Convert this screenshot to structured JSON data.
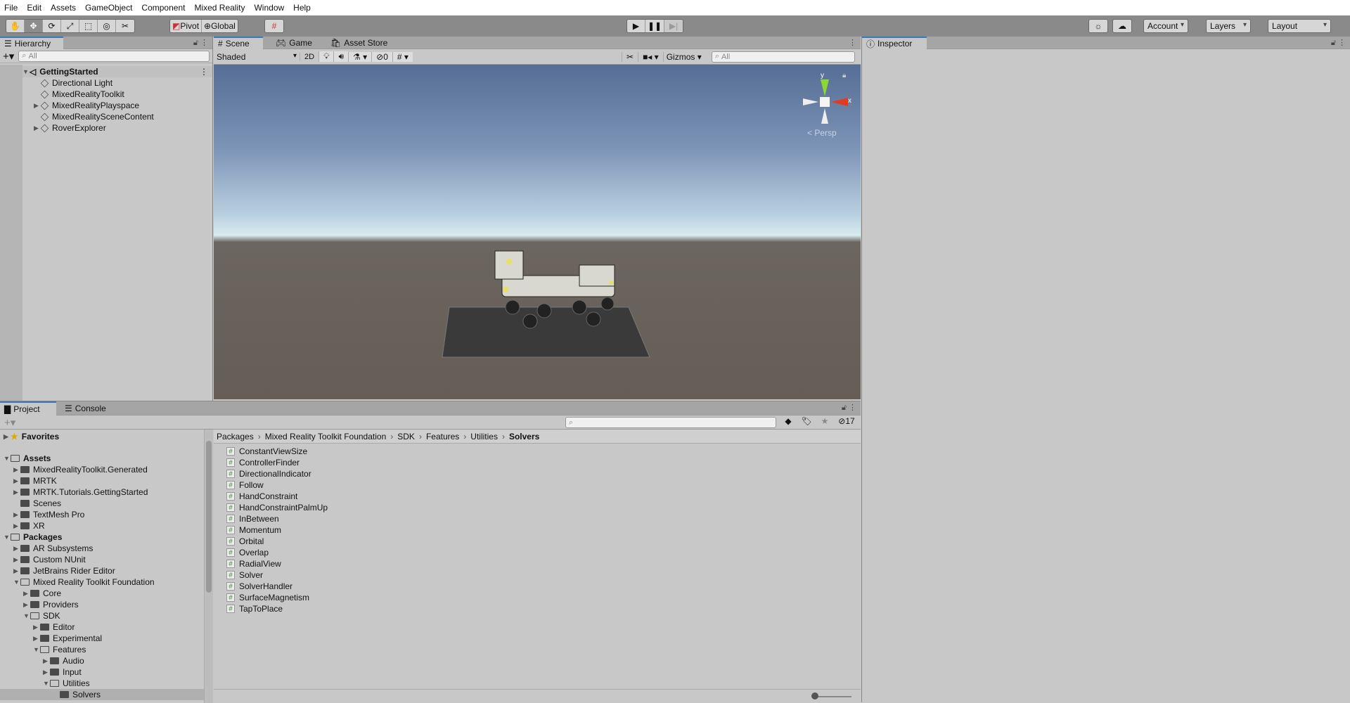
{
  "menu": [
    "File",
    "Edit",
    "Assets",
    "GameObject",
    "Component",
    "Mixed Reality",
    "Window",
    "Help"
  ],
  "toolbar": {
    "tools": [
      "hand-tool",
      "move-tool",
      "rotate-tool",
      "scale-tool",
      "rect-tool",
      "transform-tool",
      "custom-tool"
    ],
    "pivot": "Pivot",
    "global": "Global",
    "account": "Account",
    "layers": "Layers",
    "layout": "Layout"
  },
  "hierarchy": {
    "title": "Hierarchy",
    "search_placeholder": "All",
    "scene": "GettingStarted",
    "items": [
      {
        "label": "Directional Light",
        "expandable": false
      },
      {
        "label": "MixedRealityToolkit",
        "expandable": false
      },
      {
        "label": "MixedRealityPlayspace",
        "expandable": true
      },
      {
        "label": "MixedRealitySceneContent",
        "expandable": false
      },
      {
        "label": "RoverExplorer",
        "expandable": true
      }
    ]
  },
  "scene": {
    "tabs": [
      "Scene",
      "Game",
      "Asset Store"
    ],
    "shading": "Shaded",
    "mode2d": "2D",
    "hidden_count": "0",
    "gizmos": "Gizmos",
    "search_placeholder": "All",
    "gizmo": {
      "y": "y",
      "x": "x",
      "persp": "Persp"
    }
  },
  "inspector": {
    "title": "Inspector"
  },
  "project": {
    "tabs": [
      "Project",
      "Console"
    ],
    "hidden_count": "17",
    "tree": [
      {
        "label": "Favorites",
        "depth": 0,
        "arrow": "right",
        "bold": true,
        "icon": "star"
      },
      {
        "label": "Assets",
        "depth": 0,
        "arrow": "down",
        "bold": true,
        "icon": "open",
        "gap": true
      },
      {
        "label": "MixedRealityToolkit.Generated",
        "depth": 1,
        "arrow": "right"
      },
      {
        "label": "MRTK",
        "depth": 1,
        "arrow": "right"
      },
      {
        "label": "MRTK.Tutorials.GettingStarted",
        "depth": 1,
        "arrow": "right"
      },
      {
        "label": "Scenes",
        "depth": 1,
        "arrow": ""
      },
      {
        "label": "TextMesh Pro",
        "depth": 1,
        "arrow": "right"
      },
      {
        "label": "XR",
        "depth": 1,
        "arrow": "right"
      },
      {
        "label": "Packages",
        "depth": 0,
        "arrow": "down",
        "bold": true,
        "icon": "open"
      },
      {
        "label": "AR Subsystems",
        "depth": 1,
        "arrow": "right"
      },
      {
        "label": "Custom NUnit",
        "depth": 1,
        "arrow": "right"
      },
      {
        "label": "JetBrains Rider Editor",
        "depth": 1,
        "arrow": "right"
      },
      {
        "label": "Mixed Reality Toolkit Foundation",
        "depth": 1,
        "arrow": "down",
        "icon": "open"
      },
      {
        "label": "Core",
        "depth": 2,
        "arrow": "right"
      },
      {
        "label": "Providers",
        "depth": 2,
        "arrow": "right"
      },
      {
        "label": "SDK",
        "depth": 2,
        "arrow": "down",
        "icon": "open"
      },
      {
        "label": "Editor",
        "depth": 3,
        "arrow": "right"
      },
      {
        "label": "Experimental",
        "depth": 3,
        "arrow": "right"
      },
      {
        "label": "Features",
        "depth": 3,
        "arrow": "down",
        "icon": "open"
      },
      {
        "label": "Audio",
        "depth": 4,
        "arrow": "right"
      },
      {
        "label": "Input",
        "depth": 4,
        "arrow": "right"
      },
      {
        "label": "Utilities",
        "depth": 4,
        "arrow": "down",
        "icon": "open"
      },
      {
        "label": "Solvers",
        "depth": 5,
        "arrow": "",
        "selected": true
      }
    ],
    "breadcrumb": [
      "Packages",
      "Mixed Reality Toolkit Foundation",
      "SDK",
      "Features",
      "Utilities",
      "Solvers"
    ],
    "files": [
      "ConstantViewSize",
      "ControllerFinder",
      "DirectionalIndicator",
      "Follow",
      "HandConstraint",
      "HandConstraintPalmUp",
      "InBetween",
      "Momentum",
      "Orbital",
      "Overlap",
      "RadialView",
      "Solver",
      "SolverHandler",
      "SurfaceMagnetism",
      "TapToPlace"
    ]
  }
}
